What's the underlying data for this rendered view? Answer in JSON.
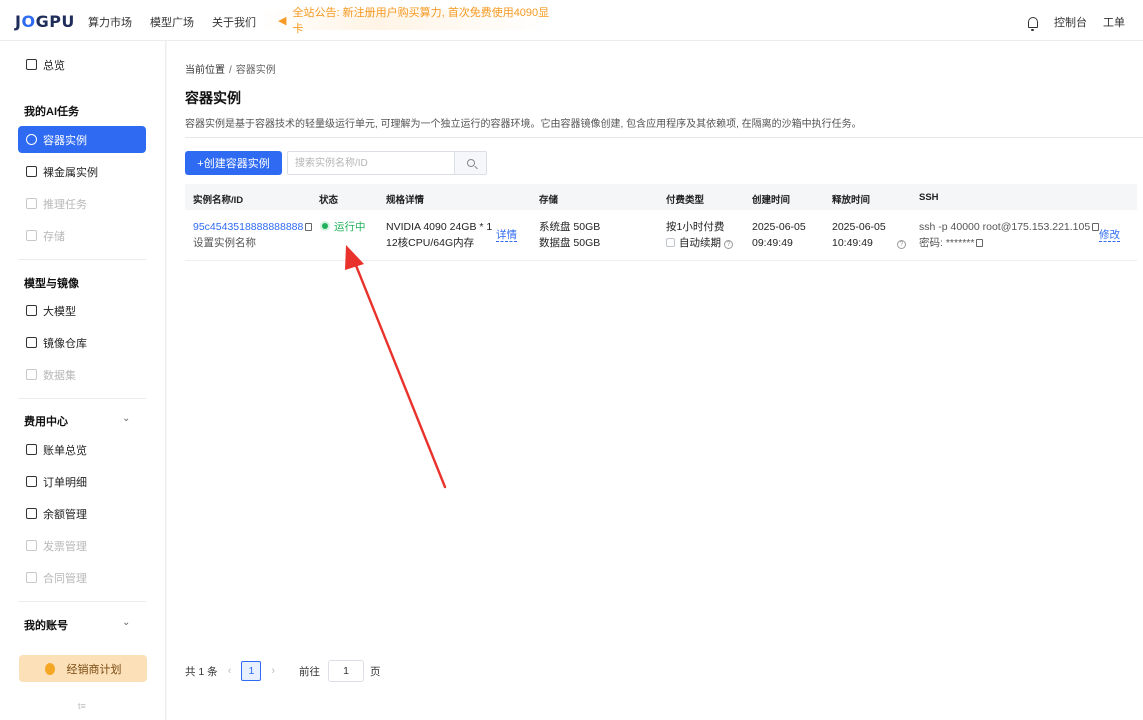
{
  "topbar": {
    "logo_a": "J",
    "logo_o": "O",
    "logo_b": "GPU",
    "nav": [
      "算力市场",
      "模型广场",
      "关于我们"
    ],
    "notice": "全站公告: 新注册用户购买算力, 首次免费使用4090显卡",
    "right_links": [
      "控制台",
      "工单"
    ]
  },
  "sidebar": {
    "overview": "总览",
    "group_tasks": "我的AI任务",
    "items_tasks": [
      "容器实例",
      "裸金属实例",
      "推理任务",
      "存储"
    ],
    "group_models": "模型与镜像",
    "items_models": [
      "大模型",
      "镜像仓库",
      "数据集"
    ],
    "group_billing": "费用中心",
    "items_billing": [
      "账单总览",
      "订单明细",
      "余额管理",
      "发票管理",
      "合同管理"
    ],
    "group_account": "我的账号",
    "promo": "经销商计划",
    "footer": "t≡"
  },
  "main": {
    "breadcrumb_root": "当前位置",
    "breadcrumb_sep": "/",
    "breadcrumb_current": "容器实例",
    "title": "容器实例",
    "description": "容器实例是基于容器技术的轻量级运行单元, 可理解为一个独立运行的容器环境。它由容器镜像创建, 包含应用程序及其依赖项, 在隔离的沙箱中执行任务。",
    "create_button": "+创建容器实例",
    "search_placeholder": "搜索实例名称/ID"
  },
  "table": {
    "headers": {
      "name": "实例名称/ID",
      "status": "状态",
      "spec": "规格详情",
      "storage": "存储",
      "billing": "付费类型",
      "created": "创建时间",
      "release": "释放时间",
      "ssh": "SSH"
    },
    "row": {
      "id": "95c4543518888888888",
      "set_name": "设置实例名称",
      "status": "运行中",
      "spec_line1": "NVIDIA 4090 24GB * 1",
      "spec_line2": "12核CPU/64G内存",
      "detail": "详情",
      "sys_disk": "系统盘 50GB",
      "data_disk": "数据盘 50GB",
      "billing_type": "按1小时付费",
      "auto_renew": "自动续期",
      "created_date": "2025-06-05",
      "created_time": "09:49:49",
      "release_date": "2025-06-05",
      "release_time": "10:49:49",
      "ssh_cmd": "ssh -p 40000 root@175.153.221.105",
      "password_label": "密码:",
      "password": "*******",
      "modify": "修改"
    }
  },
  "pager": {
    "total": "共 1 条",
    "current_page": "1",
    "goto_label": "前往",
    "goto_value": "1",
    "page_suffix": "页"
  },
  "colors": {
    "accent": "#2f6bf2",
    "status_green": "#20b25a",
    "notice_orange": "#f59a23",
    "annotation_red": "#e8322b"
  }
}
